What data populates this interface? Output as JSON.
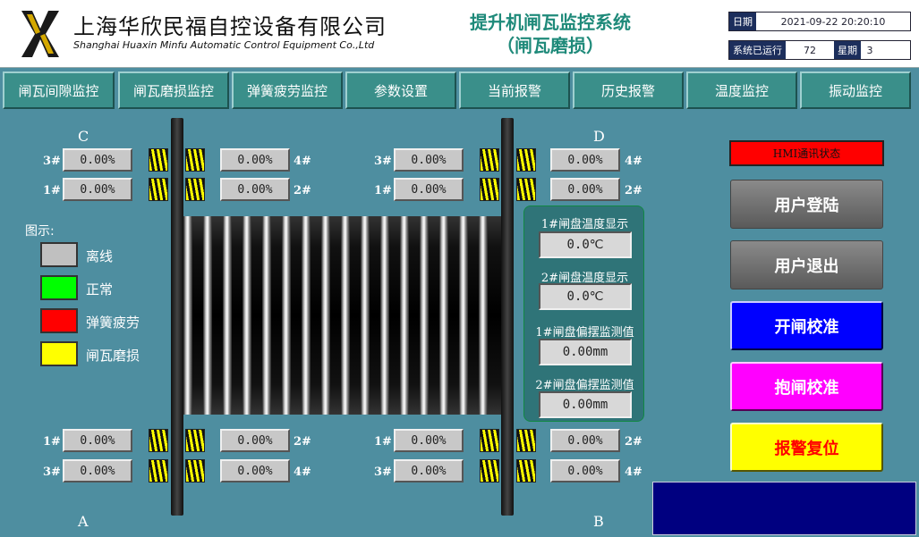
{
  "header": {
    "company_cn": "上海华欣民福自控设备有限公司",
    "company_en": "Shanghai Huaxin Minfu Automatic Control Equipment Co.,Ltd",
    "title_line1": "提升机闸瓦监控系统",
    "title_line2": "（闸瓦磨损）",
    "date_label": "日期",
    "date_value": "2021-09-22 20:20:10",
    "runtime_label": "系统已运行",
    "runtime_value": "72",
    "week_label": "星期",
    "week_value": "3"
  },
  "nav": [
    "闸瓦间隙监控",
    "闸瓦磨损监控",
    "弹簧疲劳监控",
    "参数设置",
    "当前报警",
    "历史报警",
    "温度监控",
    "振动监控"
  ],
  "corners": {
    "C": "C",
    "D": "D",
    "A": "A",
    "B": "B"
  },
  "pads": {
    "c3": {
      "label": "3#",
      "value": "0.00%"
    },
    "c4": {
      "label": "4#",
      "value": "0.00%"
    },
    "c1": {
      "label": "1#",
      "value": "0.00%"
    },
    "c2": {
      "label": "2#",
      "value": "0.00%"
    },
    "d3": {
      "label": "3#",
      "value": "0.00%"
    },
    "d4": {
      "label": "4#",
      "value": "0.00%"
    },
    "d1": {
      "label": "1#",
      "value": "0.00%"
    },
    "d2": {
      "label": "2#",
      "value": "0.00%"
    },
    "a1": {
      "label": "1#",
      "value": "0.00%"
    },
    "a2": {
      "label": "2#",
      "value": "0.00%"
    },
    "a3": {
      "label": "3#",
      "value": "0.00%"
    },
    "a4": {
      "label": "4#",
      "value": "0.00%"
    },
    "b1": {
      "label": "1#",
      "value": "0.00%"
    },
    "b2": {
      "label": "2#",
      "value": "0.00%"
    },
    "b3": {
      "label": "3#",
      "value": "0.00%"
    },
    "b4": {
      "label": "4#",
      "value": "0.00%"
    }
  },
  "legend": {
    "title": "图示:",
    "items": [
      {
        "label": "离线",
        "color": "#c0c0c0"
      },
      {
        "label": "正常",
        "color": "#00ff00"
      },
      {
        "label": "弹簧疲劳",
        "color": "#ff0000"
      },
      {
        "label": "闸瓦磨损",
        "color": "#ffff00"
      }
    ]
  },
  "monitor": {
    "temp1_label": "1#闸盘温度显示",
    "temp1_value": "0.0℃",
    "temp2_label": "2#闸盘温度显示",
    "temp2_value": "0.0℃",
    "swing1_label": "1#闸盘偏摆监测值",
    "swing1_value": "0.00mm",
    "swing2_label": "2#闸盘偏摆监测值",
    "swing2_value": "0.00mm"
  },
  "side": {
    "hmi_status": "HMI通讯状态",
    "login": "用户登陆",
    "logout": "用户退出",
    "open_calib": "开闸校准",
    "hold_calib": "抱闸校准",
    "alarm_reset": "报警复位"
  },
  "colors": {
    "background": "#4e8ea0",
    "nav_button": "#3a8f8a",
    "title_green": "#1f8a7a",
    "login_gray": "#6a6a6a",
    "open_blue": "#0000ff",
    "hold_magenta": "#ff00ff",
    "reset_yellow": "#ffff00",
    "hmi_red": "#ff0000"
  }
}
